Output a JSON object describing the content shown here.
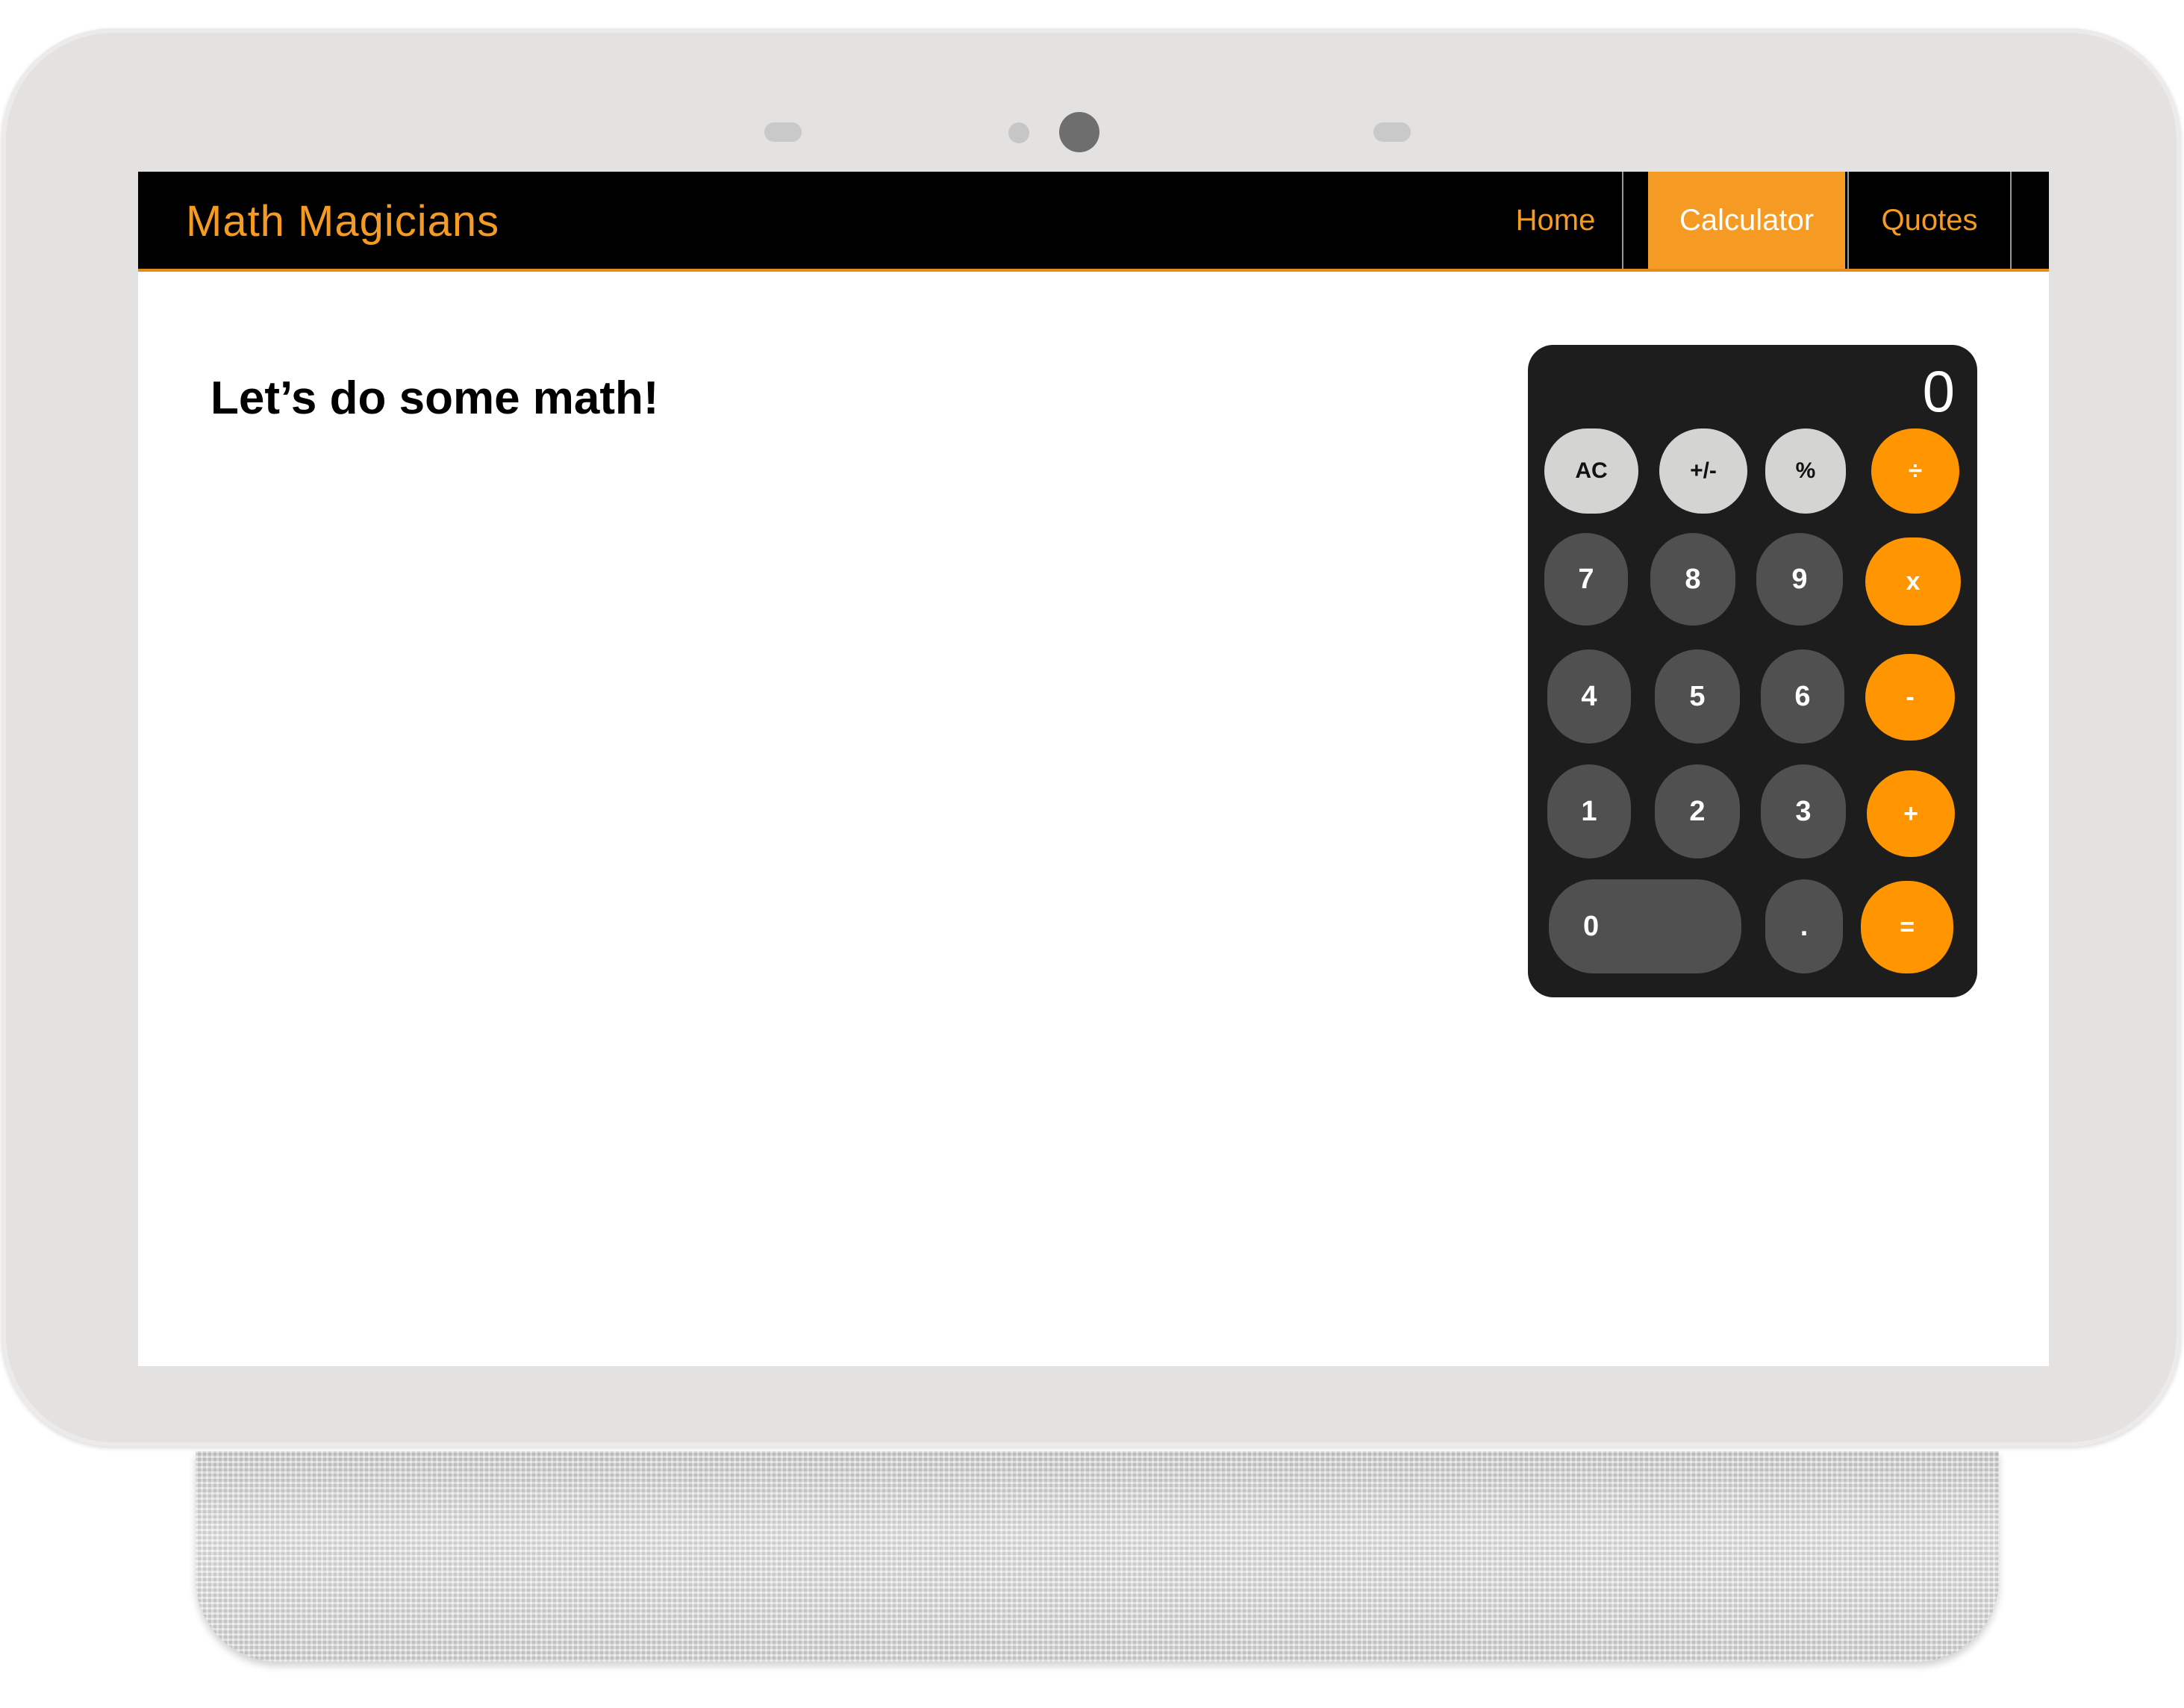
{
  "navbar": {
    "brand": "Math Magicians",
    "links": [
      "Home",
      "Calculator",
      "Quotes"
    ],
    "active": "Calculator"
  },
  "page": {
    "heading": "Let’s do some math!"
  },
  "calculator": {
    "display": "0",
    "buttons": {
      "clear": "AC",
      "sign": "+/-",
      "percent": "%",
      "divide": "÷",
      "seven": "7",
      "eight": "8",
      "nine": "9",
      "multiply": "x",
      "four": "4",
      "five": "5",
      "six": "6",
      "subtract": "-",
      "one": "1",
      "two": "2",
      "three": "3",
      "add": "+",
      "zero": "0",
      "decimal": ".",
      "equals": "="
    }
  },
  "colors": {
    "accent": "#f59a23",
    "operator": "#ff9500",
    "digit": "#505050",
    "function": "#d4d4d2",
    "calculator_body": "#1d1d1d",
    "navbar": "#000000"
  }
}
